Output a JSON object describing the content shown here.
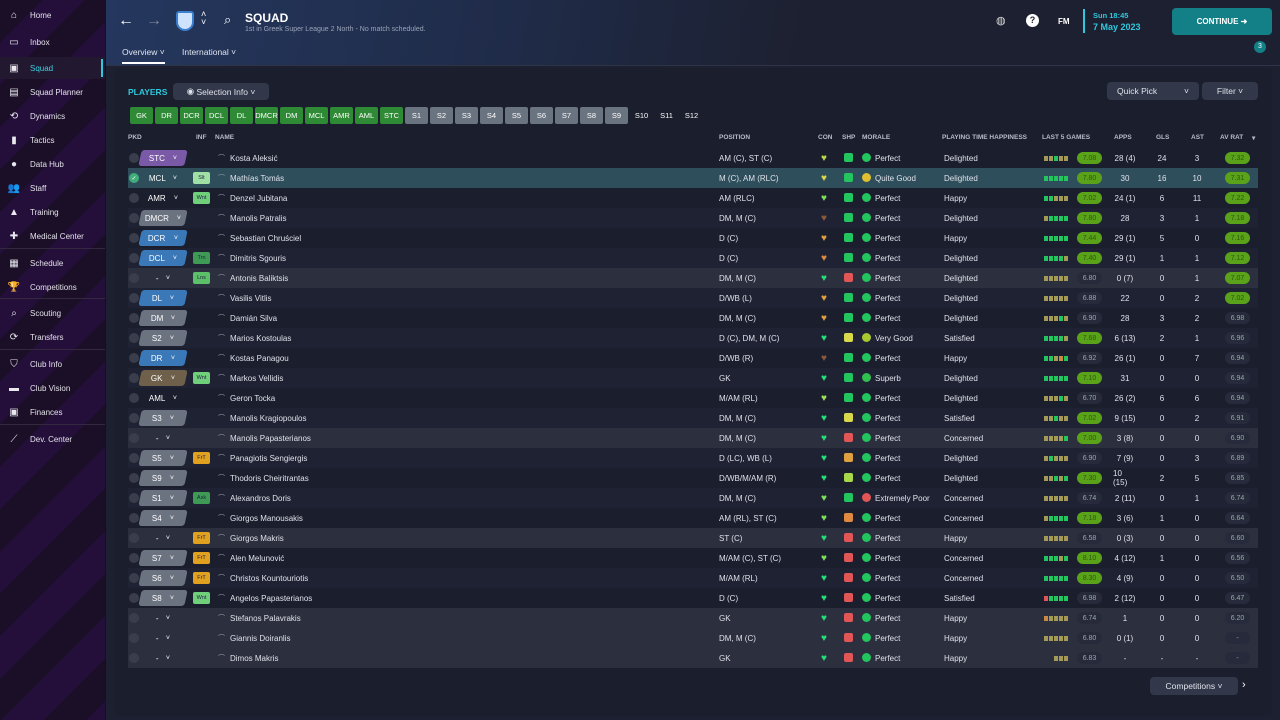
{
  "sidebar": {
    "items": [
      {
        "label": "Home",
        "icon": "home-icon",
        "glyph": "⌂"
      },
      {
        "label": "Inbox",
        "icon": "inbox-icon",
        "glyph": "▭"
      },
      {
        "label": "Squad",
        "icon": "shirt-icon",
        "glyph": "▣",
        "active": true
      },
      {
        "label": "Squad Planner",
        "icon": "clipboard-icon",
        "glyph": "▤"
      },
      {
        "label": "Dynamics",
        "icon": "dynamics-icon",
        "glyph": "⟲"
      },
      {
        "label": "Tactics",
        "icon": "tactics-icon",
        "glyph": "▮"
      },
      {
        "label": "Data Hub",
        "icon": "data-hub-icon",
        "glyph": "●"
      },
      {
        "label": "Staff",
        "icon": "staff-icon",
        "glyph": "👥"
      },
      {
        "label": "Training",
        "icon": "training-icon",
        "glyph": "▲"
      },
      {
        "label": "Medical Center",
        "icon": "medical-icon",
        "glyph": "✚"
      },
      {
        "label": "Schedule",
        "icon": "calendar-icon",
        "glyph": "▦"
      },
      {
        "label": "Competitions",
        "icon": "trophy-icon",
        "glyph": "🏆"
      },
      {
        "label": "Scouting",
        "icon": "search-icon",
        "glyph": "⌕"
      },
      {
        "label": "Transfers",
        "icon": "transfers-icon",
        "glyph": "⟳"
      },
      {
        "label": "Club Info",
        "icon": "shield-icon",
        "glyph": "⛉"
      },
      {
        "label": "Club Vision",
        "icon": "briefcase-icon",
        "glyph": "▬"
      },
      {
        "label": "Finances",
        "icon": "finances-icon",
        "glyph": "▣"
      },
      {
        "label": "Dev. Center",
        "icon": "dev-center-icon",
        "glyph": "⟋"
      }
    ]
  },
  "header": {
    "title": "SQUAD",
    "subtitle": "1st in Greek Super League 2 North - No match scheduled.",
    "tabs": [
      "Overview",
      "International"
    ],
    "fm": "FM",
    "time": "Sun 18:45",
    "date": "7 May 2023",
    "continue": "CONTINUE",
    "notifications": "3"
  },
  "players_label": "PLAYERS",
  "selection_info": "Selection Info",
  "quick_pick": "Quick Pick",
  "filter": "Filter",
  "competitions": "Competitions",
  "positions": [
    {
      "l": "GK",
      "c": "g"
    },
    {
      "l": "DR",
      "c": "g"
    },
    {
      "l": "DCR",
      "c": "g"
    },
    {
      "l": "DCL",
      "c": "g"
    },
    {
      "l": "DL",
      "c": "g"
    },
    {
      "l": "DMCR",
      "c": "g"
    },
    {
      "l": "DM",
      "c": "g"
    },
    {
      "l": "MCL",
      "c": "g"
    },
    {
      "l": "AMR",
      "c": "g"
    },
    {
      "l": "AML",
      "c": "g"
    },
    {
      "l": "STC",
      "c": "g"
    },
    {
      "l": "S1",
      "c": "s"
    },
    {
      "l": "S2",
      "c": "s"
    },
    {
      "l": "S3",
      "c": "s"
    },
    {
      "l": "S4",
      "c": "s"
    },
    {
      "l": "S5",
      "c": "s"
    },
    {
      "l": "S6",
      "c": "s"
    },
    {
      "l": "S7",
      "c": "s"
    },
    {
      "l": "S8",
      "c": "s"
    },
    {
      "l": "S9",
      "c": "s"
    },
    {
      "l": "S10",
      "c": "n"
    },
    {
      "l": "S11",
      "c": "n"
    },
    {
      "l": "S12",
      "c": "n"
    }
  ],
  "columns": {
    "pkd": "PKD",
    "inf": "INF",
    "name": "NAME",
    "position": "POSITION",
    "con": "CON",
    "shp": "SHP",
    "morale": "MORALE",
    "pth": "PLAYING TIME HAPPINESS",
    "last5": "LAST 5 GAMES",
    "apps": "APPS",
    "gls": "GLS",
    "ast": "AST",
    "avrat": "AV RAT"
  },
  "colors": {
    "purple": "#7a5aa6",
    "blue": "#3a78b8",
    "grey": "#6c7380",
    "brown": "#6e604a",
    "accent": "#2fc8dc",
    "continue": "#137f86"
  },
  "players": [
    {
      "sel": "STC",
      "sc": "purple",
      "inf": "",
      "name": "Kosta Aleksić",
      "pos": "AM (C), ST (C)",
      "con": "#b8d84a",
      "shp": "#22c55e",
      "mor": "Perfect",
      "mc": "#22c55e",
      "pth": "Delighted",
      "l5": "ttgtt",
      "form": "7.08",
      "fh": 1,
      "apps": "28 (4)",
      "gls": "24",
      "ast": "3",
      "av": "7.32",
      "ah": 1
    },
    {
      "sel": "MCL",
      "sc": "",
      "inf": "Slt",
      "ic": "#9fe0a5",
      "name": "Mathías Tomás",
      "pos": "M (C), AM (RLC)",
      "con": "#d8d84a",
      "shp": "#22c55e",
      "mor": "Quite Good",
      "mc": "#e0c030",
      "pth": "Delighted",
      "l5": "ggggg",
      "form": "7.80",
      "fh": 1,
      "apps": "30",
      "gls": "16",
      "ast": "10",
      "av": "7.31",
      "ah": 1,
      "row": "sel",
      "pk": 1
    },
    {
      "sel": "AMR",
      "sc": "",
      "inf": "Wnt",
      "ic": "#6fcf7a",
      "name": "Denzel Jubitana",
      "pos": "AM (RLC)",
      "con": "#7ee05a",
      "shp": "#22c55e",
      "mor": "Perfect",
      "mc": "#22c55e",
      "pth": "Happy",
      "l5": "ggttt",
      "form": "7.02",
      "fh": 1,
      "apps": "24 (1)",
      "gls": "6",
      "ast": "11",
      "av": "7.22",
      "ah": 1
    },
    {
      "sel": "DMCR",
      "sc": "grey",
      "inf": "",
      "name": "Manolis Patralis",
      "pos": "DM, M (C)",
      "con": "#8a5a3a",
      "shp": "#22c55e",
      "mor": "Perfect",
      "mc": "#22c55e",
      "pth": "Delighted",
      "l5": "tgggg",
      "form": "7.80",
      "fh": 1,
      "apps": "28",
      "gls": "3",
      "ast": "1",
      "av": "7.18",
      "ah": 1
    },
    {
      "sel": "DCR",
      "sc": "blue",
      "inf": "",
      "name": "Sebastian Chruściel",
      "pos": "D (C)",
      "con": "#e0a040",
      "shp": "#22c55e",
      "mor": "Perfect",
      "mc": "#22c55e",
      "pth": "Happy",
      "l5": "ggggg",
      "form": "7.44",
      "fh": 1,
      "apps": "29 (1)",
      "gls": "5",
      "ast": "0",
      "av": "7.16",
      "ah": 1
    },
    {
      "sel": "DCL",
      "sc": "blue",
      "inf": "Trn",
      "ic": "#3f9a55",
      "name": "Dimitris Sgouris",
      "pos": "D (C)",
      "con": "#e08a40",
      "shp": "#22c55e",
      "mor": "Perfect",
      "mc": "#22c55e",
      "pth": "Delighted",
      "l5": "ggggt",
      "form": "7.40",
      "fh": 1,
      "apps": "29 (1)",
      "gls": "1",
      "ast": "1",
      "av": "7.12",
      "ah": 1
    },
    {
      "sel": "-",
      "sc": "",
      "inf": "Lns",
      "ic": "#5cbf6a",
      "name": "Antonis Baliktsis",
      "pos": "DM, M (C)",
      "con": "#22e07a",
      "shp": "#e05555",
      "mor": "Perfect",
      "mc": "#22c55e",
      "pth": "Delighted",
      "l5": "ttttt",
      "form": "6.80",
      "fh": 0,
      "apps": "0 (7)",
      "gls": "0",
      "ast": "1",
      "av": "7.07",
      "ah": 1,
      "row": "grey"
    },
    {
      "sel": "DL",
      "sc": "blue",
      "inf": "",
      "name": "Vasilis Vitlis",
      "pos": "D/WB (L)",
      "con": "#e0a040",
      "shp": "#22c55e",
      "mor": "Perfect",
      "mc": "#22c55e",
      "pth": "Delighted",
      "l5": "ttttt",
      "form": "6.88",
      "fh": 0,
      "apps": "22",
      "gls": "0",
      "ast": "2",
      "av": "7.02",
      "ah": 1
    },
    {
      "sel": "DM",
      "sc": "grey",
      "inf": "",
      "name": "Damián Silva",
      "pos": "DM, M (C)",
      "con": "#e0a040",
      "shp": "#22c55e",
      "mor": "Perfect",
      "mc": "#22c55e",
      "pth": "Delighted",
      "l5": "tttgt",
      "form": "6.90",
      "fh": 0,
      "apps": "28",
      "gls": "3",
      "ast": "2",
      "av": "6.98",
      "ah": 0
    },
    {
      "sel": "S2",
      "sc": "grey",
      "inf": "",
      "name": "Marios Kostoulas",
      "pos": "D (C), DM, M (C)",
      "con": "#22e07a",
      "shp": "#d8d84a",
      "mor": "Very Good",
      "mc": "#a8c830",
      "pth": "Satisfied",
      "l5": "ggggt",
      "form": "7.68",
      "fh": 1,
      "apps": "6 (13)",
      "gls": "2",
      "ast": "1",
      "av": "6.96",
      "ah": 0
    },
    {
      "sel": "DR",
      "sc": "blue",
      "inf": "",
      "name": "Kostas Panagou",
      "pos": "D/WB (R)",
      "con": "#8a5a3a",
      "shp": "#22c55e",
      "mor": "Perfect",
      "mc": "#22c55e",
      "pth": "Happy",
      "l5": "ggtog",
      "form": "6.92",
      "fh": 0,
      "apps": "26 (1)",
      "gls": "0",
      "ast": "7",
      "av": "6.94",
      "ah": 0
    },
    {
      "sel": "GK",
      "sc": "brown",
      "inf": "Wnt",
      "ic": "#6fcf7a",
      "name": "Markos Vellidis",
      "pos": "GK",
      "con": "#22e07a",
      "shp": "#22c55e",
      "mor": "Superb",
      "mc": "#30c050",
      "pth": "Delighted",
      "l5": "ggggg",
      "form": "7.10",
      "fh": 1,
      "apps": "31",
      "gls": "0",
      "ast": "0",
      "av": "6.94",
      "ah": 0
    },
    {
      "sel": "AML",
      "sc": "",
      "inf": "",
      "name": "Geron Tocka",
      "pos": "M/AM (RL)",
      "con": "#9ee05a",
      "shp": "#22c55e",
      "mor": "Perfect",
      "mc": "#22c55e",
      "pth": "Delighted",
      "l5": "tttgt",
      "form": "6.70",
      "fh": 0,
      "apps": "26 (2)",
      "gls": "6",
      "ast": "6",
      "av": "6.94",
      "ah": 0
    },
    {
      "sel": "S3",
      "sc": "grey",
      "inf": "",
      "name": "Manolis Kragiopoulos",
      "pos": "DM, M (C)",
      "con": "#22e07a",
      "shp": "#d8d84a",
      "mor": "Perfect",
      "mc": "#22c55e",
      "pth": "Satisfied",
      "l5": "ttgtt",
      "form": "7.02",
      "fh": 1,
      "apps": "9 (15)",
      "gls": "0",
      "ast": "2",
      "av": "6.91",
      "ah": 0
    },
    {
      "sel": "-",
      "sc": "",
      "inf": "",
      "name": "Manolis Papasterianos",
      "pos": "DM, M (C)",
      "con": "#22e07a",
      "shp": "#e05555",
      "mor": "Perfect",
      "mc": "#22c55e",
      "pth": "Concerned",
      "l5": "ttttg",
      "form": "7.00",
      "fh": 1,
      "apps": "3 (8)",
      "gls": "0",
      "ast": "0",
      "av": "6.90",
      "ah": 0,
      "row": "grey"
    },
    {
      "sel": "S5",
      "sc": "grey",
      "inf": "FrT",
      "ic": "#e0a020",
      "name": "Panagiotis Sengiergis",
      "pos": "D (LC), WB (L)",
      "con": "#22e07a",
      "shp": "#e0a040",
      "mor": "Perfect",
      "mc": "#22c55e",
      "pth": "Delighted",
      "l5": "tgttt",
      "form": "6.90",
      "fh": 0,
      "apps": "7 (9)",
      "gls": "0",
      "ast": "3",
      "av": "6.89",
      "ah": 0
    },
    {
      "sel": "S9",
      "sc": "grey",
      "inf": "",
      "name": "Thodoris Cheiritrantas",
      "pos": "D/WB/M/AM (R)",
      "con": "#22e07a",
      "shp": "#a8d84a",
      "mor": "Perfect",
      "mc": "#22c55e",
      "pth": "Delighted",
      "l5": "ttgtg",
      "form": "7.30",
      "fh": 1,
      "apps": "10 (15)",
      "gls": "2",
      "ast": "5",
      "av": "6.85",
      "ah": 0
    },
    {
      "sel": "S1",
      "sc": "grey",
      "inf": "Ask",
      "ic": "#3f9a55",
      "name": "Alexandros Doris",
      "pos": "DM, M (C)",
      "con": "#7ee05a",
      "shp": "#22c55e",
      "mor": "Extremely Poor",
      "mc": "#e05555",
      "pth": "Concerned",
      "l5": "ttttt",
      "form": "6.74",
      "fh": 0,
      "apps": "2 (11)",
      "gls": "0",
      "ast": "1",
      "av": "6.74",
      "ah": 0
    },
    {
      "sel": "S4",
      "sc": "grey",
      "inf": "",
      "name": "Giorgos Manousakis",
      "pos": "AM (RL), ST (C)",
      "con": "#7ee05a",
      "shp": "#e08a40",
      "mor": "Perfect",
      "mc": "#22c55e",
      "pth": "Concerned",
      "l5": "tgggg",
      "form": "7.18",
      "fh": 1,
      "apps": "3 (6)",
      "gls": "1",
      "ast": "0",
      "av": "6.64",
      "ah": 0
    },
    {
      "sel": "-",
      "sc": "",
      "inf": "FrT",
      "ic": "#e0a020",
      "name": "Giorgos Makris",
      "pos": "ST (C)",
      "con": "#22e07a",
      "shp": "#e05555",
      "mor": "Perfect",
      "mc": "#22c55e",
      "pth": "Happy",
      "l5": "ttttt",
      "form": "6.58",
      "fh": 0,
      "apps": "0 (3)",
      "gls": "0",
      "ast": "0",
      "av": "6.60",
      "ah": 0,
      "row": "grey"
    },
    {
      "sel": "S7",
      "sc": "grey",
      "inf": "FrT",
      "ic": "#e0a020",
      "name": "Alen Melunović",
      "pos": "M/AM (C), ST (C)",
      "con": "#7ee05a",
      "shp": "#e05555",
      "mor": "Perfect",
      "mc": "#22c55e",
      "pth": "Concerned",
      "l5": "gggtg",
      "form": "8.10",
      "fh": 1,
      "apps": "4 (12)",
      "gls": "1",
      "ast": "0",
      "av": "6.56",
      "ah": 0
    },
    {
      "sel": "S6",
      "sc": "grey",
      "inf": "FrT",
      "ic": "#e0a020",
      "name": "Christos Kountouriotis",
      "pos": "M/AM (RL)",
      "con": "#22e07a",
      "shp": "#e05555",
      "mor": "Perfect",
      "mc": "#22c55e",
      "pth": "Concerned",
      "l5": "ggggg",
      "form": "8.30",
      "fh": 1,
      "apps": "4 (9)",
      "gls": "0",
      "ast": "0",
      "av": "6.50",
      "ah": 0
    },
    {
      "sel": "S8",
      "sc": "grey",
      "inf": "Wnt",
      "ic": "#6fcf7a",
      "name": "Angelos Papasterianos",
      "pos": "D (C)",
      "con": "#22e07a",
      "shp": "#e05555",
      "mor": "Perfect",
      "mc": "#22c55e",
      "pth": "Satisfied",
      "l5": "rgggg",
      "form": "6.98",
      "fh": 0,
      "apps": "2 (12)",
      "gls": "0",
      "ast": "0",
      "av": "6.47",
      "ah": 0
    },
    {
      "sel": "-",
      "sc": "",
      "inf": "",
      "name": "Stefanos Palavrakis",
      "pos": "GK",
      "con": "#22e07a",
      "shp": "#e05555",
      "mor": "Perfect",
      "mc": "#22c55e",
      "pth": "Happy",
      "l5": "otttt",
      "form": "6.74",
      "fh": 0,
      "apps": "1",
      "gls": "0",
      "ast": "0",
      "av": "6.20",
      "ah": 0,
      "row": "grey"
    },
    {
      "sel": "-",
      "sc": "",
      "inf": "",
      "name": "Giannis Doiranlis",
      "pos": "DM, M (C)",
      "con": "#22e07a",
      "shp": "#e05555",
      "mor": "Perfect",
      "mc": "#22c55e",
      "pth": "Happy",
      "l5": "ttttt",
      "form": "6.80",
      "fh": 0,
      "apps": "0 (1)",
      "gls": "0",
      "ast": "0",
      "av": "-",
      "ah": 0,
      "row": "grey"
    },
    {
      "sel": "-",
      "sc": "",
      "inf": "",
      "name": "Dimos Makris",
      "pos": "GK",
      "con": "#22e07a",
      "shp": "#e05555",
      "mor": "Perfect",
      "mc": "#22c55e",
      "pth": "Happy",
      "l5": "ttt",
      "form": "6.83",
      "fh": 0,
      "apps": "-",
      "gls": "-",
      "ast": "-",
      "av": "-",
      "ah": 0,
      "row": "grey"
    }
  ]
}
